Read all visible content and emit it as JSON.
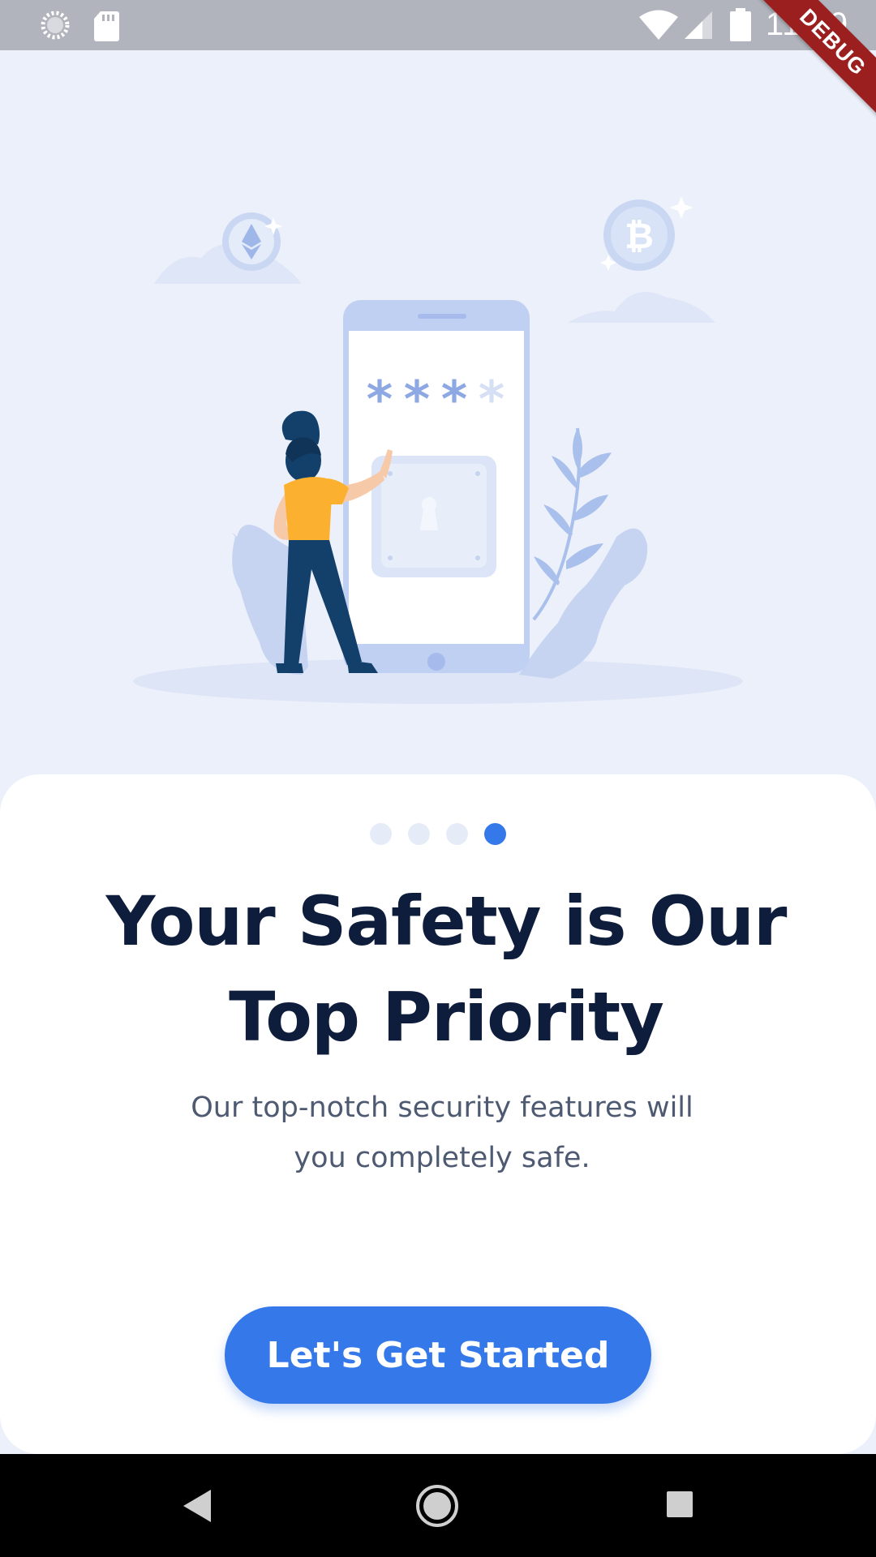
{
  "status_bar": {
    "time": "11:19",
    "icons": [
      "loading-icon",
      "sd-card-icon",
      "wifi-icon",
      "cell-signal-icon",
      "battery-icon"
    ]
  },
  "debug_banner": {
    "label": "DEBUG"
  },
  "illustration": {
    "icons": [
      "ethereum-coin-icon",
      "bitcoin-coin-icon",
      "phone-lock-icon",
      "person-figure",
      "plant-icon"
    ],
    "password_mask": [
      "*",
      "*",
      "*",
      "*"
    ]
  },
  "onboarding": {
    "page_count": 4,
    "current_page": 4,
    "title": "Your Safety is Our Top Priority",
    "subtitle": "Our top-notch security features will you completely safe.",
    "cta_label": "Let's Get Started"
  },
  "colors": {
    "accent": "#3578ea",
    "title": "#0f1d3d",
    "subtitle": "#4e5a72",
    "background": "#ecf0fa",
    "illustration_light": "#c6d4f2",
    "person_shirt": "#fbb12f",
    "person_pants": "#13406b"
  },
  "nav_bar": {
    "buttons": [
      "back-icon",
      "home-icon",
      "recents-icon"
    ]
  }
}
